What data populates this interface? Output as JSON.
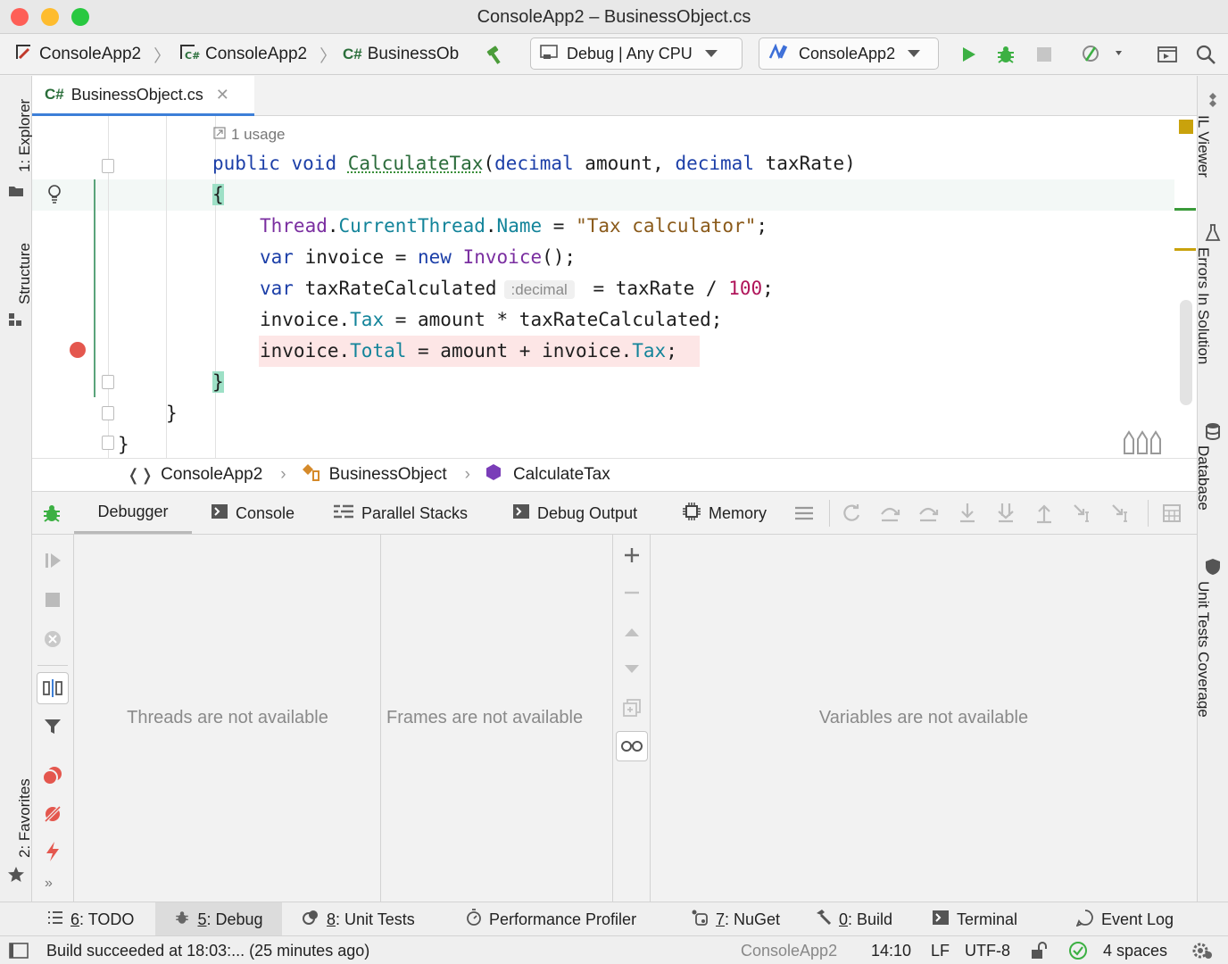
{
  "window": {
    "title": "ConsoleApp2 – BusinessObject.cs"
  },
  "toolbar": {
    "crumb1": "ConsoleApp2",
    "crumb2": "ConsoleApp2",
    "crumb3_badge": "C#",
    "crumb3": "BusinessOb",
    "config": "Debug | Any CPU",
    "run_target": "ConsoleApp2"
  },
  "left_tabs": {
    "explorer": "1: Explorer",
    "structure": "Structure",
    "favorites": "2: Favorites"
  },
  "right_tabs": {
    "il_viewer": "IL Viewer",
    "errors": "Errors In Solution",
    "database": "Database",
    "unit_tests": "Unit Tests Coverage"
  },
  "editor_tab": {
    "badge": "C#",
    "filename": "BusinessObject.cs"
  },
  "code": {
    "usage_hint": "1 usage",
    "inlay_hint": ":decimal",
    "l_sig_kw1": "public",
    "l_sig_kw2": "void",
    "l_sig_fn": "CalculateTax",
    "l_sig_p1t": "decimal",
    "l_sig_p1": "amount,",
    "l_sig_p2t": "decimal",
    "l_sig_p2": "taxRate)",
    "l_brace_open": "{",
    "l1_a": "Thread",
    "l1_b": ".",
    "l1_c": "CurrentThread",
    "l1_d": ".",
    "l1_e": "Name",
    "l1_f": " = ",
    "l1_g": "\"Tax calculator\"",
    "l1_h": ";",
    "l2_a": "var",
    "l2_b": " invoice = ",
    "l2_c": "new",
    "l2_d": " ",
    "l2_e": "Invoice",
    "l2_f": "();",
    "l3_a": "var",
    "l3_b": " taxRateCalculated",
    "l3_c": " = taxRate / ",
    "l3_d": "100",
    "l3_e": ";",
    "l4_a": "invoice.",
    "l4_b": "Tax",
    "l4_c": " = amount * taxRateCalculated;",
    "l5_a": "invoice.",
    "l5_b": "Total",
    "l5_c": " = amount + invoice.",
    "l5_d": "Tax",
    "l5_e": ";",
    "l_brace_close": "}",
    "l_brace_class": "}",
    "l_brace_ns": "}"
  },
  "breadcrumb": {
    "ns": "ConsoleApp2",
    "cls": "BusinessObject",
    "method": "CalculateTax"
  },
  "debug_tabs": {
    "debugger": "Debugger",
    "console": "Console",
    "parallel": "Parallel Stacks",
    "output": "Debug Output",
    "memory": "Memory"
  },
  "panes": {
    "threads": "Threads are not available",
    "frames": "Frames are not available",
    "variables": "Variables are not available"
  },
  "tool_tabs": {
    "todo_n": "6",
    "todo": ": TODO",
    "debug_n": "5",
    "debug": ": Debug",
    "unit_n": "8",
    "unit": ": Unit Tests",
    "profiler": "Performance Profiler",
    "nuget_n": "7",
    "nuget": ": NuGet",
    "build_n": "0",
    "build": ": Build",
    "terminal": "Terminal",
    "event_log": "Event Log"
  },
  "status": {
    "message": "Build succeeded at 18:03:... (25 minutes ago)",
    "project": "ConsoleApp2",
    "position": "14:10",
    "line_ending": "LF",
    "encoding": "UTF-8",
    "indent": "4 spaces"
  },
  "colors": {
    "accent": "#3d7fd8",
    "run": "#3cb043",
    "breakpoint": "#e4574e",
    "bp_line": "#fde9e9",
    "caret_line": "#f2f7f5"
  }
}
